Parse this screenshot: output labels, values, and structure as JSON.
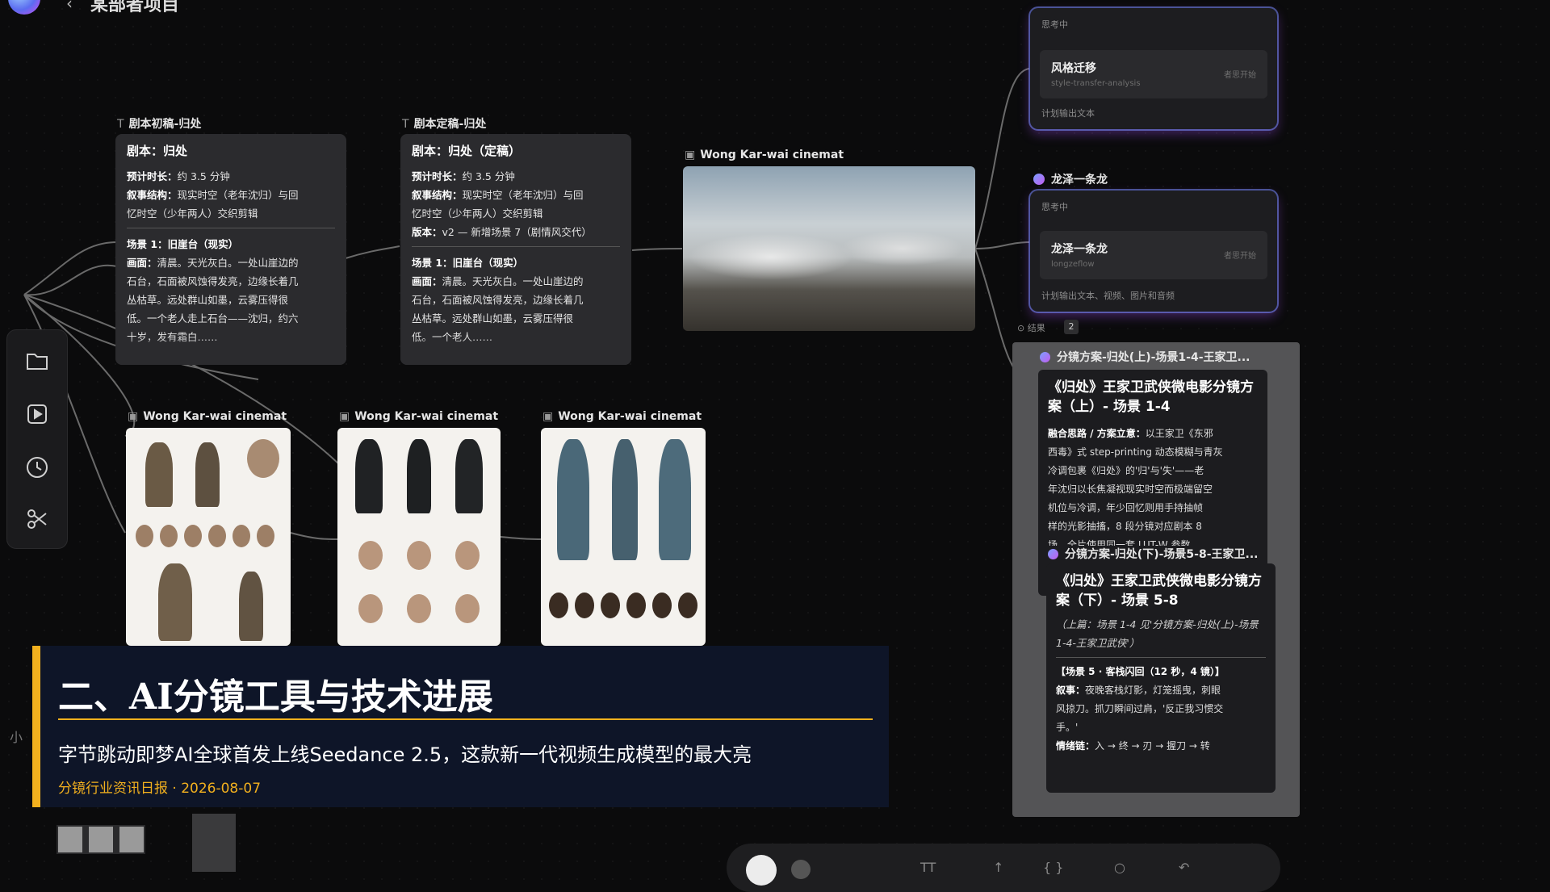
{
  "canvas": {
    "project_title": "某部者项目"
  },
  "script_nodes": [
    {
      "caption": "剧本初稿-归处",
      "title": "剧本：归处",
      "lines": [
        {
          "k": "预计时长：",
          "v": "约 3.5 分钟"
        },
        {
          "k": "叙事结构：",
          "v": "现实时空（老年沈归）与回"
        },
        {
          "k": "",
          "v": "忆时空（少年两人）交织剪辑"
        },
        {
          "k": "场景 1：",
          "v": "旧崖台（现实）"
        },
        {
          "k": "画面：",
          "v": "清晨。天光灰白。一处山崖边的"
        },
        {
          "k": "",
          "v": "石台，石面被风蚀得发亮，边缘长着几"
        },
        {
          "k": "",
          "v": "丛枯草。远处群山如墨，云雾压得很"
        },
        {
          "k": "",
          "v": "低。一个老人走上石台——沈归，约六"
        },
        {
          "k": "",
          "v": "十岁，发有霜白……"
        }
      ]
    },
    {
      "caption": "剧本定稿-归处",
      "title": "剧本：归处（定稿）",
      "lines": [
        {
          "k": "预计时长：",
          "v": "约 3.5 分钟"
        },
        {
          "k": "叙事结构：",
          "v": "现实时空（老年沈归）与回"
        },
        {
          "k": "",
          "v": "忆时空（少年两人）交织剪辑"
        },
        {
          "k": "版本：",
          "v": "v2 — 新增场景 7（剧情风交代）"
        },
        {
          "k": "场景 1：",
          "v": "旧崖台（现实）"
        },
        {
          "k": "画面：",
          "v": "清晨。天光灰白。一处山崖边的"
        },
        {
          "k": "",
          "v": "石台，石面被风蚀得发亮，边缘长着几"
        },
        {
          "k": "",
          "v": "丛枯草。远处群山如墨，云雾压得很"
        },
        {
          "k": "",
          "v": "低。一个老人……"
        }
      ]
    }
  ],
  "image_nodes": [
    {
      "caption": "Wong Kar-wai cinemat",
      "kind": "landscape"
    },
    {
      "caption": "Wong Kar-wai cinemat",
      "kind": "character-sheet-old"
    },
    {
      "caption": "Wong Kar-wai cinemat",
      "kind": "character-sheet-black"
    },
    {
      "caption": "Wong Kar-wai cinemat",
      "kind": "character-sheet-blue"
    }
  ],
  "sidebar": {
    "items": [
      {
        "name": "folder-icon"
      },
      {
        "name": "video-icon"
      },
      {
        "name": "clock-icon"
      },
      {
        "name": "scissors-icon"
      }
    ]
  },
  "right_panels": {
    "style_panel": {
      "status": "思考中",
      "item_title": "风格迁移",
      "item_sub": "style-transfer-analysis",
      "item_tag": "者思开始",
      "footer": "计划输出文本"
    },
    "master_panel": {
      "title": "龙泽一条龙",
      "status": "思考中",
      "item_title": "龙泽一条龙",
      "item_sub": "longzeflow",
      "item_tag": "者思开始",
      "footer": "计划输出文本、视频、图片和音频"
    },
    "result_row": {
      "label": "结果",
      "count": "2"
    }
  },
  "storyboard_panel": {
    "header": "分镜方案-归处(上)-场景1-4-王家卫...",
    "card1": {
      "title": "《归处》王家卫武侠微电影分镜方案（上）- 场景 1-4",
      "lines": [
        {
          "k": "融合思路 / 方案立意：",
          "v": "以王家卫《东邪"
        },
        {
          "k": "",
          "v": "西毒》式 step-printing 动态模糊与青灰"
        },
        {
          "k": "",
          "v": "冷调包裹《归处》的'归'与'失'——老"
        },
        {
          "k": "",
          "v": "年沈归以长焦凝视现实时空而极端留空"
        },
        {
          "k": "",
          "v": "机位与冷调，年少回忆则用手持抽帧"
        },
        {
          "k": "",
          "v": "样的光影抽搐，8 段分镜对应剧本 8"
        },
        {
          "k": "",
          "v": "场，全片使用同一套 LUT-W 参数。"
        }
      ]
    },
    "card2_header": "分镜方案-归处(下)-场景5-8-王家卫...",
    "card2": {
      "title": "《归处》王家卫武侠微电影分镜方案（下）- 场景 5-8",
      "italic": "（上篇：场景 1-4 见'分镜方案-归处(上)-场景1-4-王家卫武侠'）",
      "scene": "【场景 5 · 客栈闪回（12 秒，4 镜）】",
      "lines": [
        {
          "k": "叙事：",
          "v": "夜晚客栈灯影，灯笼摇曳，刺眼"
        },
        {
          "k": "",
          "v": "风掠刀。抓刀瞬间过肩，'反正我习惯交"
        },
        {
          "k": "",
          "v": "手。'"
        },
        {
          "k": "情绪链：",
          "v": "入 → 终 → 刃 → 握刀 → 转"
        }
      ]
    }
  },
  "news_overlay": {
    "heading": "二、AI分镜工具与技术进展",
    "body": "字节跳动即梦AI全球首发上线Seedance 2.5，这款新一代视频生成模型的最大亮",
    "meta": "分镜行业资讯日报 · 2026-08-07",
    "accent": "#f2b01e",
    "background": "#0e1528"
  },
  "left_fragment": {
    "label": "小"
  }
}
